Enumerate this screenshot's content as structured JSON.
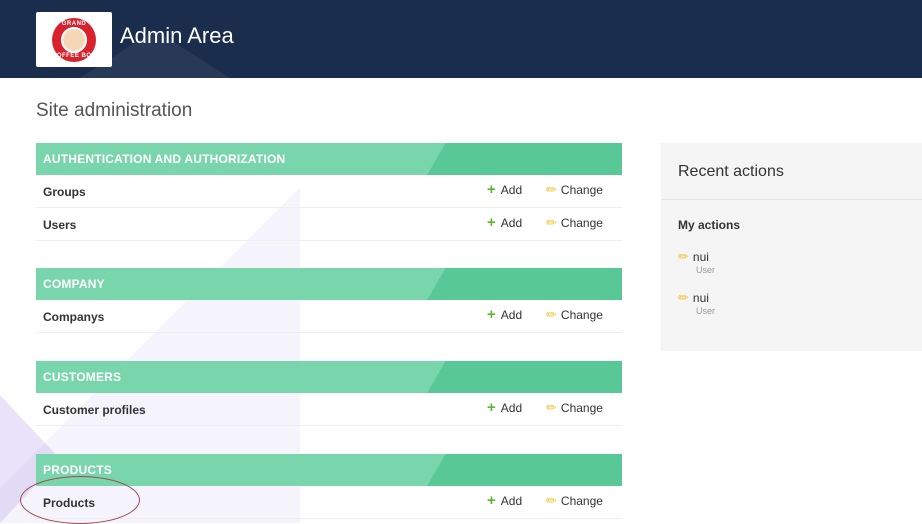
{
  "header": {
    "site_name": "Admin Area",
    "logo": {
      "text_top": "GRAND",
      "text_bottom": "COFFEE BOY"
    }
  },
  "page_title": "Site administration",
  "actions": {
    "add_label": "Add",
    "change_label": "Change"
  },
  "modules": [
    {
      "caption": "AUTHENTICATION AND AUTHORIZATION",
      "models": [
        {
          "name": "Groups"
        },
        {
          "name": "Users"
        }
      ]
    },
    {
      "caption": "COMPANY",
      "models": [
        {
          "name": "Companys"
        }
      ]
    },
    {
      "caption": "CUSTOMERS",
      "models": [
        {
          "name": "Customer profiles"
        }
      ]
    },
    {
      "caption": "PRODUCTS",
      "models": [
        {
          "name": "Products"
        }
      ]
    }
  ],
  "recent_actions": {
    "title": "Recent actions",
    "subtitle": "My actions",
    "items": [
      {
        "name": "nui",
        "type": "User"
      },
      {
        "name": "nui",
        "type": "User"
      }
    ]
  },
  "colors": {
    "header_bg": "#1a2d4d",
    "module_header": "#79d5ab",
    "add_icon": "#5cb531",
    "change_icon": "#f2c12e",
    "annotation": "#a0484f"
  },
  "icons": {
    "add": "plus-icon",
    "change": "pencil-icon"
  }
}
